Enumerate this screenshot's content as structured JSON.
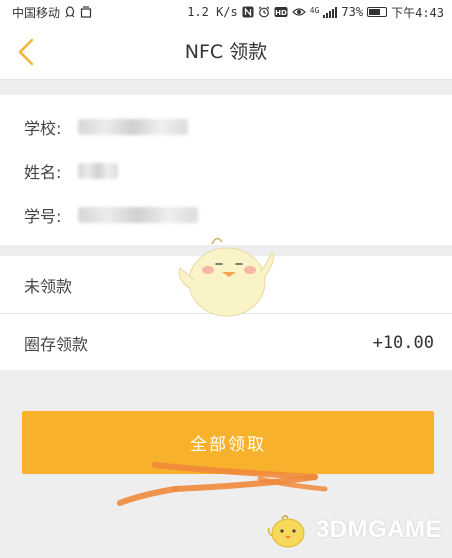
{
  "status_bar": {
    "carrier": "中国移动",
    "speed": "1.2 K/s",
    "network": "4G",
    "battery": "73%",
    "battery_level": 0.73,
    "time": "下午4:43"
  },
  "header": {
    "title": "NFC 领款"
  },
  "info": {
    "school_label": "学校:",
    "name_label": "姓名:",
    "student_id_label": "学号:"
  },
  "amounts": {
    "unclaimed_label": "未领款",
    "held_label": "圈存领款",
    "held_value": "+10.00"
  },
  "actions": {
    "collect_all_label": "全部领取"
  },
  "watermark": {
    "text": "3DMGAME"
  },
  "colors": {
    "accent": "#f8b12c",
    "annotation": "#f0883a"
  }
}
